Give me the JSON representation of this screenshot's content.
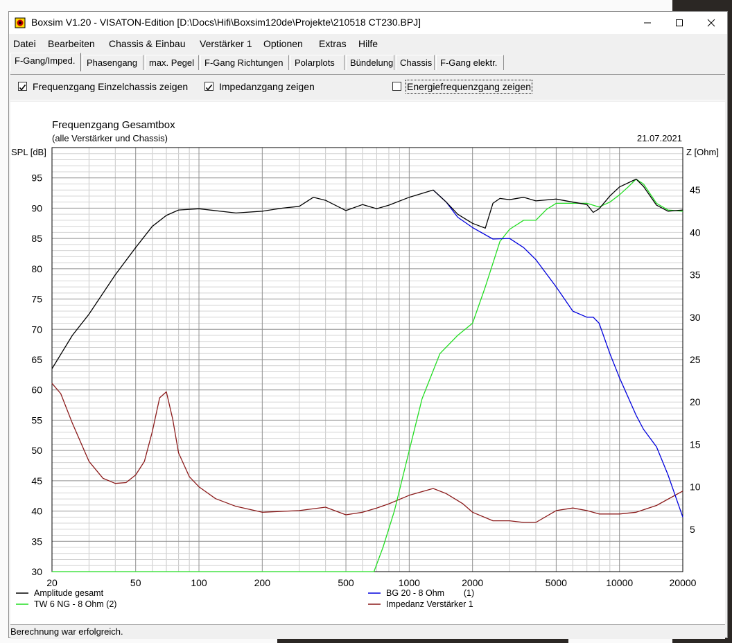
{
  "window": {
    "title": "Boxsim V1.20 - VISATON-Edition [D:\\Docs\\Hifi\\Boxsim120de\\Projekte\\210518 CT230.BPJ]"
  },
  "menu": [
    "Datei",
    "Bearbeiten",
    "Chassis & Einbau",
    "Verstärker 1",
    "Optionen",
    "Extras",
    "Hilfe"
  ],
  "tabs": [
    "F-Gang/Imped.",
    "Phasengang",
    "max. Pegel",
    "F-Gang Richtungen",
    "Polarplots",
    "Bündelung",
    "Chassis",
    "F-Gang elektr."
  ],
  "active_tab": "F-Gang/Imped.",
  "options": [
    {
      "label": "Frequenzgang Einzelchassis zeigen",
      "checked": true
    },
    {
      "label": "Impedanzgang zeigen",
      "checked": true
    },
    {
      "label": "Energiefrequenzgang zeigen",
      "checked": false
    }
  ],
  "status": "Berechnung war erfolgreich.",
  "colors": {
    "amplitude": "#000000",
    "bg20": "#0000dd",
    "tw6": "#22dd22",
    "impedance": "#8b1a1a"
  },
  "chart_data": {
    "type": "line",
    "title": "Frequenzgang Gesamtbox",
    "subtitle": "(alle Verstärker und Chassis)",
    "date": "21.07.2021",
    "ylabel": "SPL [dB]",
    "y2label": "Z [Ohm]",
    "xscale": "log",
    "xlim": [
      20,
      20000
    ],
    "ylim": [
      30,
      100
    ],
    "y2lim": [
      0,
      50
    ],
    "x_ticks": [
      "20",
      "50",
      "100",
      "200",
      "500",
      "1000",
      "2000",
      "5000",
      "10000",
      "20000"
    ],
    "y_ticks": [
      "95",
      "90",
      "85",
      "80",
      "75",
      "70",
      "65",
      "60",
      "55",
      "50",
      "45",
      "40",
      "35",
      "30"
    ],
    "y2_ticks": [
      "45",
      "40",
      "35",
      "30",
      "25",
      "20",
      "15",
      "10",
      "5"
    ],
    "legend": [
      {
        "label": "Amplitude gesamt",
        "key": "amplitude"
      },
      {
        "label": "TW 6 NG - 8 Ohm (2)",
        "key": "tw6"
      },
      {
        "label": "BG 20 - 8 Ohm        (1)",
        "key": "bg20"
      },
      {
        "label": "Impedanz Verstärker 1",
        "key": "impedance"
      }
    ],
    "series": [
      {
        "name": "Amplitude gesamt",
        "key": "amplitude",
        "axis": "left",
        "x": [
          20,
          25,
          30,
          40,
          50,
          60,
          70,
          80,
          100,
          150,
          200,
          250,
          300,
          350,
          400,
          500,
          600,
          700,
          800,
          1000,
          1300,
          1500,
          1700,
          2000,
          2300,
          2500,
          2700,
          3000,
          3500,
          4000,
          5000,
          6000,
          7000,
          7500,
          8000,
          9000,
          10000,
          12000,
          13000,
          15000,
          17000,
          20000
        ],
        "y": [
          63.5,
          69,
          72.5,
          79,
          83.5,
          87,
          88.8,
          89.7,
          89.9,
          89.2,
          89.5,
          90,
          90.3,
          91.8,
          91.3,
          89.6,
          90.6,
          89.9,
          90.5,
          91.8,
          93,
          91,
          89,
          87.5,
          86.7,
          90.8,
          91.6,
          91.4,
          91.8,
          91.2,
          91.5,
          91,
          90.6,
          89.3,
          89.9,
          92,
          93.5,
          94.8,
          93.6,
          90.5,
          89.5,
          89.7
        ]
      },
      {
        "name": "BG 20 - 8 Ohm",
        "key": "bg20",
        "axis": "left",
        "x": [
          1300,
          1500,
          1700,
          2000,
          2500,
          3000,
          3500,
          4000,
          5000,
          6000,
          7000,
          7500,
          8000,
          9000,
          10000,
          12000,
          13000,
          15000,
          17000,
          20000
        ],
        "y": [
          93,
          91,
          88.5,
          86.8,
          84.9,
          85,
          83.5,
          81.5,
          77,
          73,
          72,
          72,
          71,
          66,
          62,
          55.8,
          53.5,
          50.6,
          46,
          39
        ]
      },
      {
        "name": "TW 6 NG - 8 Ohm",
        "key": "tw6",
        "axis": "left",
        "x": [
          20,
          680,
          750,
          850,
          1000,
          1150,
          1400,
          1700,
          2000,
          2300,
          2700,
          3000,
          3500,
          4000,
          4500,
          5000,
          6000,
          7000,
          8000,
          9000,
          10000,
          11000,
          12000,
          13000,
          15000,
          17000,
          20000
        ],
        "y": [
          30,
          30,
          34,
          40,
          50,
          58.5,
          66,
          69,
          71,
          77,
          84.5,
          86.5,
          88,
          88,
          89.8,
          90.8,
          90.8,
          90.8,
          90.2,
          91,
          92.2,
          93.5,
          94.8,
          94,
          90.8,
          89.7,
          89.5
        ]
      },
      {
        "name": "Impedanz Verstärker 1",
        "key": "impedance",
        "axis": "right",
        "x": [
          20,
          22,
          25,
          30,
          35,
          40,
          45,
          50,
          55,
          60,
          65,
          70,
          75,
          80,
          90,
          100,
          120,
          150,
          200,
          300,
          400,
          500,
          600,
          700,
          800,
          1000,
          1300,
          1500,
          1800,
          2000,
          2500,
          3000,
          3500,
          4000,
          5000,
          6000,
          7000,
          8000,
          10000,
          12000,
          15000,
          20000
        ],
        "y": [
          22.2,
          21,
          17.5,
          13,
          11,
          10.4,
          10.5,
          11.4,
          13,
          16.5,
          20.5,
          21.2,
          18,
          14,
          11.2,
          10,
          8.6,
          7.7,
          7,
          7.2,
          7.6,
          6.7,
          7,
          7.5,
          8,
          9,
          9.8,
          9.2,
          8,
          7,
          6,
          6,
          5.8,
          5.8,
          7.2,
          7.5,
          7.2,
          6.8,
          6.8,
          7,
          7.8,
          9.5
        ]
      }
    ]
  }
}
